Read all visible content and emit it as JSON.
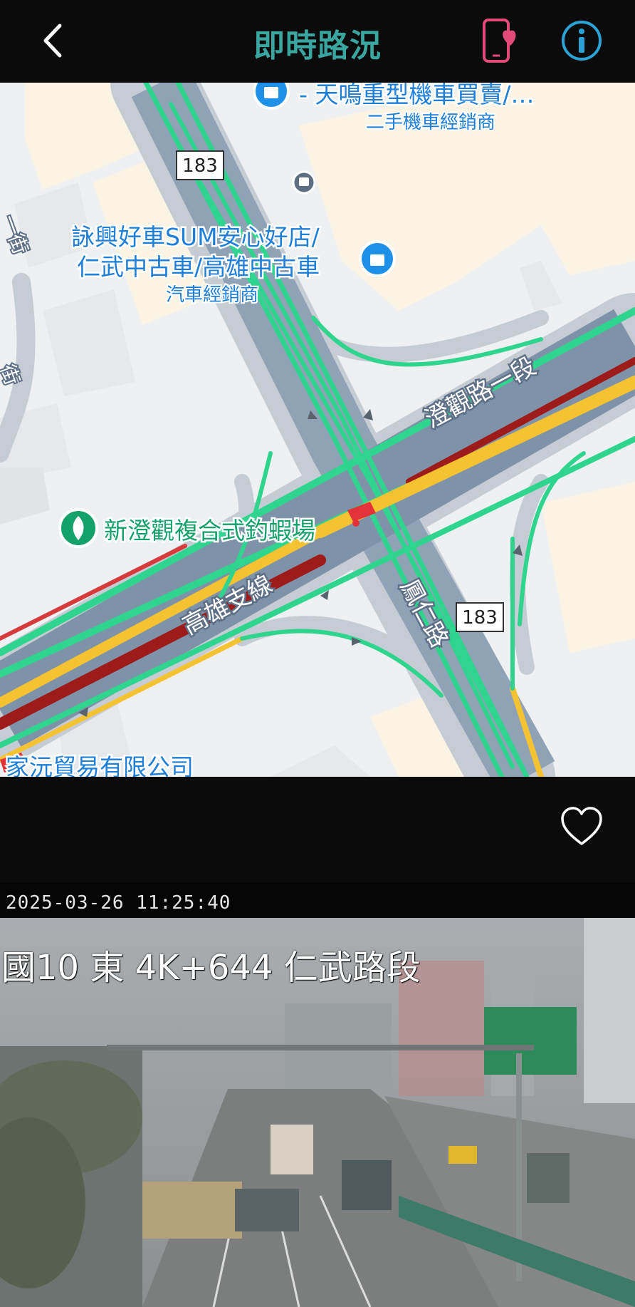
{
  "header": {
    "title": "即時路況",
    "back_icon": "back-chevron-icon",
    "favorite_phone_icon": "phone-heart-icon",
    "info_icon": "info-icon",
    "title_color": "#3aa6a0",
    "phone_icon_color": "#e24a7a",
    "info_icon_color": "#2aa3d8"
  },
  "map": {
    "pois": [
      {
        "name": "- 天鳴重型機車買賣/…",
        "category": "二手機車經銷商"
      },
      {
        "name_line1": "詠興好車SUM安心好店/",
        "name_line2": "仁武中古車/高雄中古車",
        "category": "汽車經銷商"
      },
      {
        "name": "新澄觀複合式釣蝦場"
      },
      {
        "name": "家沅貿易有限公司"
      }
    ],
    "roads": {
      "chengguan": "澄觀路一段",
      "kaohsiung_branch": "高雄支線",
      "fengren": "鳳仁路",
      "route_shield_top": "183",
      "route_shield_bottom": "183",
      "partial_left_1": "一街",
      "partial_left_2": "街"
    },
    "traffic_colors": {
      "free": "#2fd58e",
      "slow": "#f5c232",
      "jam": "#d63a3a",
      "severe": "#9e1b1b"
    }
  },
  "favorite": {
    "icon": "heart-outline-icon"
  },
  "camera": {
    "timestamp": "2025-03-26   11:25:40",
    "location": "國10 東 4K+644 仁武路段"
  }
}
